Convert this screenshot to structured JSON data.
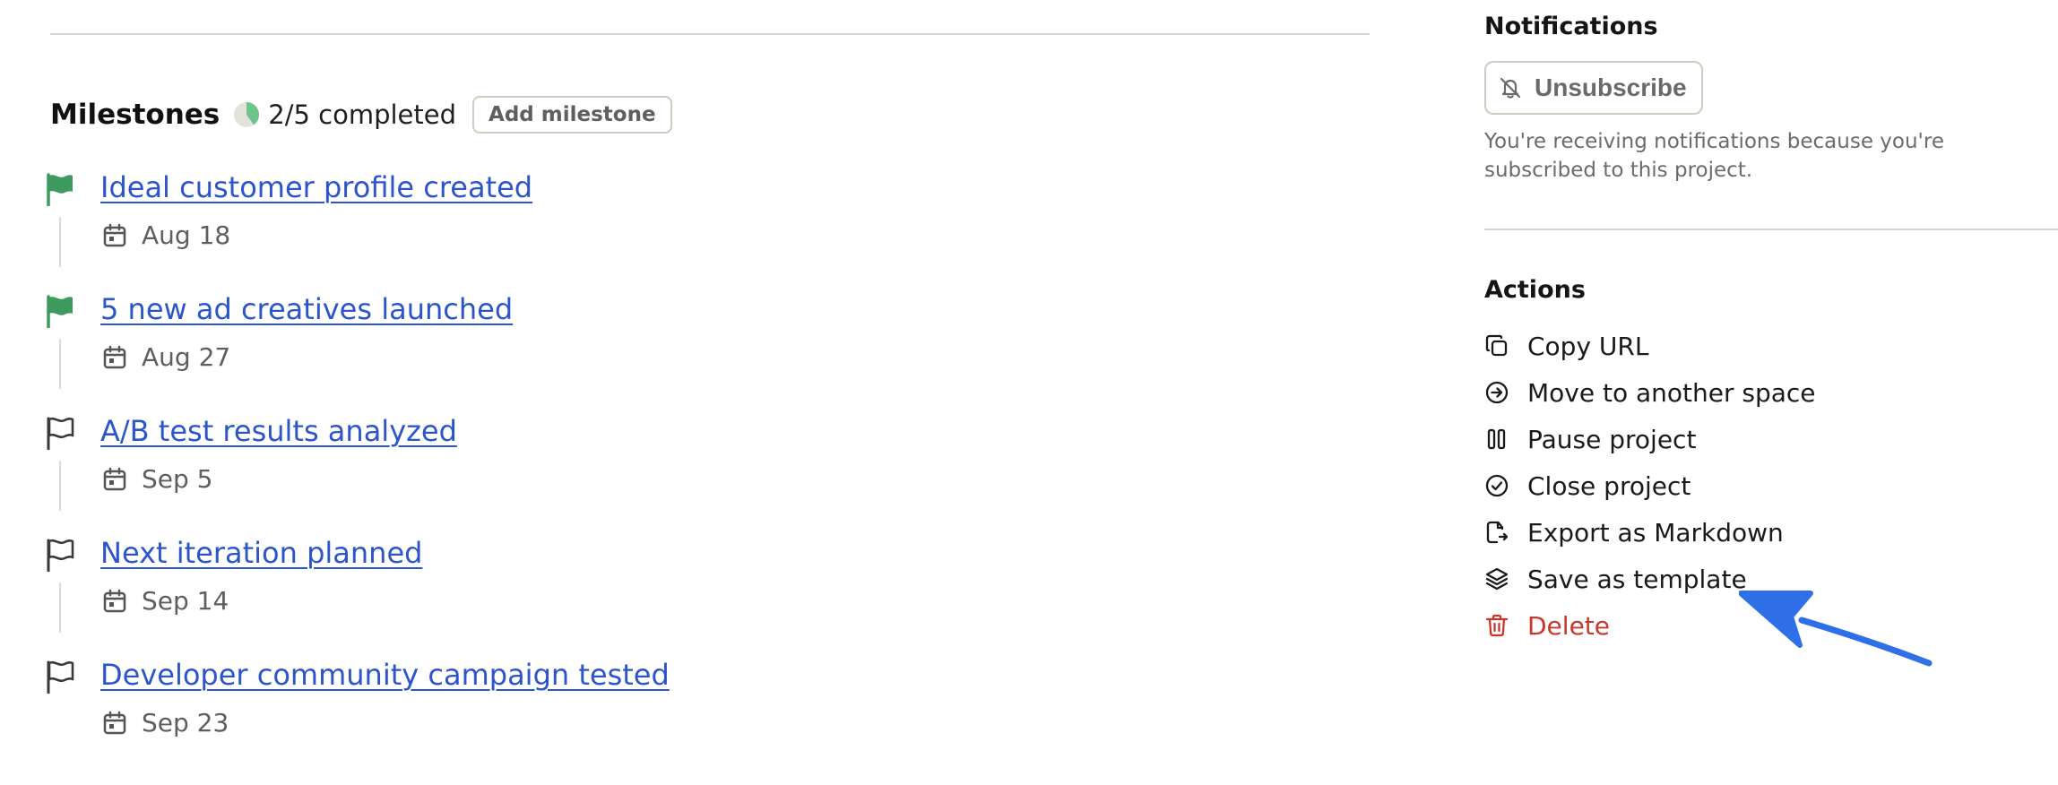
{
  "milestones": {
    "title": "Milestones",
    "progress_text": "2/5 completed",
    "progress_fraction": 0.4,
    "add_button_label": "Add milestone",
    "items": [
      {
        "title": "Ideal customer profile created",
        "date": "Aug 18",
        "completed": true
      },
      {
        "title": "5 new ad creatives launched",
        "date": "Aug 27",
        "completed": true
      },
      {
        "title": "A/B test results analyzed",
        "date": "Sep 5",
        "completed": false
      },
      {
        "title": "Next iteration planned",
        "date": "Sep 14",
        "completed": false
      },
      {
        "title": "Developer community campaign tested",
        "date": "Sep 23",
        "completed": false
      }
    ]
  },
  "notifications": {
    "heading": "Notifications",
    "unsubscribe_label": "Unsubscribe",
    "description": "You're receiving notifications because you're subscribed to this project."
  },
  "actions": {
    "heading": "Actions",
    "items": [
      {
        "label": "Copy URL",
        "icon": "copy-icon"
      },
      {
        "label": "Move to another space",
        "icon": "arrow-circle-right-icon"
      },
      {
        "label": "Pause project",
        "icon": "pause-icon"
      },
      {
        "label": "Close project",
        "icon": "check-circle-icon"
      },
      {
        "label": "Export as Markdown",
        "icon": "file-export-icon"
      },
      {
        "label": "Save as template",
        "icon": "layers-icon"
      },
      {
        "label": "Delete",
        "icon": "trash-icon"
      }
    ]
  },
  "colors": {
    "link": "#2b55c9",
    "flag_completed": "#3f9a5f",
    "flag_open": "#3a3a3a",
    "danger": "#c9362b",
    "divider": "#d9d6cc",
    "annotation_arrow": "#2f6fe8"
  }
}
